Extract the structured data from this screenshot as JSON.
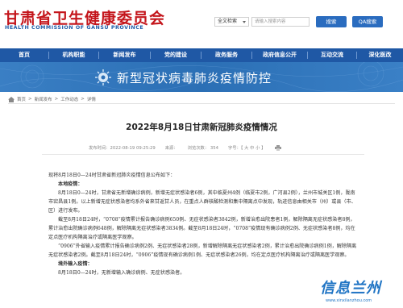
{
  "header": {
    "title": "甘肃省卫生健康委员会",
    "subtitle": "HEALTH COMMISSION OF GANSU PROVINCE",
    "site_select": "全文检索",
    "search_placeholder": "请输入搜索内容",
    "search_button": "搜索",
    "qa_button": "QA搜索"
  },
  "nav": {
    "items": [
      "首页",
      "机构职能",
      "新闻发布",
      "党的建设",
      "政务服务",
      "政府信息公开",
      "互动交流",
      "深化医改"
    ]
  },
  "banner": {
    "title": "新型冠状病毒肺炎疫情防控"
  },
  "breadcrumb": [
    "首页",
    "新闻发布",
    "工作动态",
    "详情"
  ],
  "article": {
    "title": "2022年8月18日甘肃新冠肺炎疫情情况",
    "meta_date": "发布时间：2022-08-19 09:25:29",
    "meta_source": "来源：",
    "meta_views": "浏览次数：  354",
    "meta_font": "字号：【 大 中 小 】",
    "intro": "现将8月18日0—24时甘肃省新冠肺炎疫情信息公布如下：",
    "h1": "本地疫情：",
    "p1": "8月18日0—24时，甘肃省无新增确诊病例，新增无症状感染者6例，其中临夏州4例（临夏市2例，广河县2例），兰州市城关区1例，陇南市宕昌县1例。以上新增无症状感染者均系外省来甘返甘人员，在重点人群核酸检测和集中隔离点中发现，轨迹信息由相关市（州）或县（市、区）进行发布。",
    "p2": "截至8月18日24时，“0708”疫情累计报告确诊病例650例、无症状感染者3842例，新增治愈出院患者1例，解除隔离无症状感染者8例，累计治愈出院确诊病例648例，解除隔离无症状感染者3834例。截至8月18日24时，“0708”疫情现有确诊病例2例、无症状感染者8例，均在定点医疗机构隔离治疗或隔离医学观察。",
    "p3": "“0906”外省输入疫情累计报告确诊病例2例、无症状感染者28例，新增解除隔离无症状感染者2例，累计治愈出院确诊病例1例，解除隔离无症状感染者2例。截至8月18日24时，“0906”疫情现有确诊病例1例、无症状感染者26例，均在定点医疗机构隔离治疗或隔离医学观察。",
    "h2": "境外输入疫情：",
    "p4": "8月18日0—24时，无新增输入确诊病例、无症状感染者。"
  },
  "watermark": {
    "text": "信息兰州",
    "url": "www.xinxilanzhou.com"
  },
  "colors": {
    "brand_red": "#c4161c",
    "nav_blue": "#1f58a5",
    "banner_blue": "#2b6fb5"
  }
}
